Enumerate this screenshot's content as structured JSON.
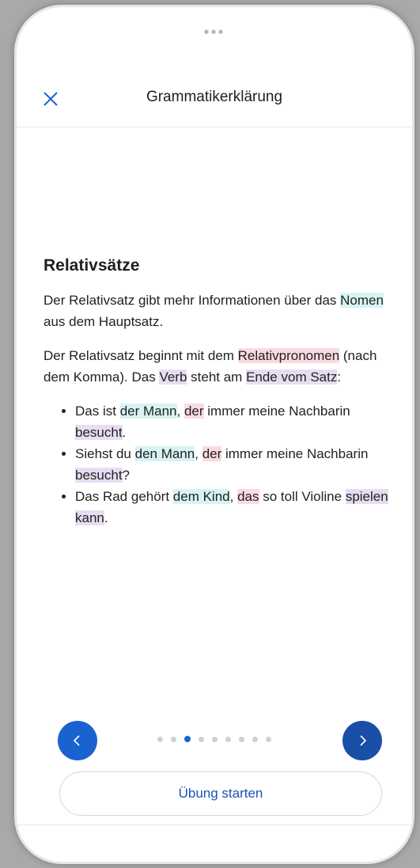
{
  "status_bar": {
    "handle": "•••"
  },
  "header": {
    "close_icon": "close-icon",
    "title": "Grammatikerklärung"
  },
  "content": {
    "heading": "Relativsätze",
    "p1": {
      "text1": "Der Relativsatz gibt mehr Informationen über das ",
      "noun": "Nomen",
      "text2": " aus dem Hauptsatz."
    },
    "p2": {
      "text1": "Der Relativsatz beginnt mit dem ",
      "relpron": "Relativpronomen",
      "text2": " (nach dem Komma). Das ",
      "verb": "Verb",
      "text3": " steht am ",
      "end": "Ende vom Satz",
      "text4": ":"
    },
    "examples": [
      {
        "pre": "Das ist ",
        "noun": "der Mann",
        "comma": ", ",
        "pron": "der",
        "mid": " immer meine Nachbarin ",
        "verb": "besucht",
        "end": "."
      },
      {
        "pre": "Siehst du ",
        "noun": "den Mann",
        "comma": ", ",
        "pron": "der",
        "mid": " immer meine Nachbarin ",
        "verb": "besucht",
        "end": "?"
      },
      {
        "pre": "Das Rad gehört ",
        "noun": "dem Kind",
        "comma": ", ",
        "pron": "das",
        "mid": " so toll Violine ",
        "verb": "spielen kann",
        "end": "."
      }
    ]
  },
  "highlight_colors": {
    "noun": "#d7f3f3",
    "pronoun": "#fadbe1",
    "verb": "#e7ddf2",
    "accent": "#1b62d1"
  },
  "navigation": {
    "prev_icon": "chevron-left-icon",
    "next_icon": "chevron-right-icon",
    "pages_total": 9,
    "current_page": 3
  },
  "action": {
    "start_label": "Übung starten"
  }
}
